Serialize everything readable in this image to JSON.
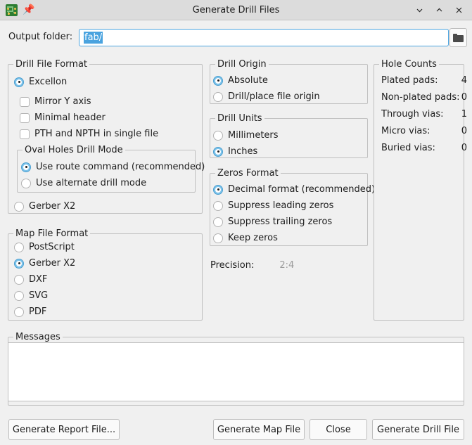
{
  "window": {
    "title": "Generate Drill Files",
    "app_icon": "pcb-board-icon",
    "pin_icon": "pin-icon",
    "controls": [
      {
        "name": "minimize-button",
        "icon": "chevron-down-icon"
      },
      {
        "name": "maximize-button",
        "icon": "chevron-up-icon"
      },
      {
        "name": "close-button",
        "icon": "close-icon"
      }
    ]
  },
  "output": {
    "label": "Output folder:",
    "value": "fab/",
    "browse_icon": "folder-icon"
  },
  "drill_file_format": {
    "title": "Drill File Format",
    "options": [
      {
        "label": "Excellon",
        "selected": true
      },
      {
        "label": "Gerber X2",
        "selected": false
      }
    ],
    "excellon_checks": [
      {
        "label": "Mirror Y axis",
        "checked": false
      },
      {
        "label": "Minimal header",
        "checked": false
      },
      {
        "label": "PTH and NPTH in single file",
        "checked": false
      }
    ],
    "oval_holes": {
      "title": "Oval Holes Drill Mode",
      "options": [
        {
          "label": "Use route command (recommended)",
          "selected": true
        },
        {
          "label": "Use alternate drill mode",
          "selected": false
        }
      ]
    }
  },
  "map_file_format": {
    "title": "Map File Format",
    "options": [
      {
        "label": "PostScript",
        "selected": false
      },
      {
        "label": "Gerber X2",
        "selected": true
      },
      {
        "label": "DXF",
        "selected": false
      },
      {
        "label": "SVG",
        "selected": false
      },
      {
        "label": "PDF",
        "selected": false
      }
    ]
  },
  "drill_origin": {
    "title": "Drill Origin",
    "options": [
      {
        "label": "Absolute",
        "selected": true
      },
      {
        "label": "Drill/place file origin",
        "selected": false
      }
    ]
  },
  "drill_units": {
    "title": "Drill Units",
    "options": [
      {
        "label": "Millimeters",
        "selected": false
      },
      {
        "label": "Inches",
        "selected": true
      }
    ]
  },
  "zeros_format": {
    "title": "Zeros Format",
    "options": [
      {
        "label": "Decimal format (recommended)",
        "selected": true
      },
      {
        "label": "Suppress leading zeros",
        "selected": false
      },
      {
        "label": "Suppress trailing zeros",
        "selected": false
      },
      {
        "label": "Keep zeros",
        "selected": false
      }
    ]
  },
  "precision": {
    "label": "Precision:",
    "value": "2:4",
    "disabled": true
  },
  "hole_counts": {
    "title": "Hole Counts",
    "rows": [
      {
        "label": "Plated pads:",
        "value": "4"
      },
      {
        "label": "Non-plated pads:",
        "value": "0"
      },
      {
        "label": "Through vias:",
        "value": "1"
      },
      {
        "label": "Micro vias:",
        "value": "0"
      },
      {
        "label": "Buried vias:",
        "value": "0"
      }
    ]
  },
  "messages": {
    "title": "Messages",
    "content": ""
  },
  "buttons": {
    "report": "Generate Report File...",
    "map": "Generate Map File",
    "close": "Close",
    "drill": "Generate Drill File"
  },
  "colors": {
    "accent": "#4aa3df",
    "dialog_bg": "#f0f0f0",
    "titlebar_bg": "#dcdcdc",
    "radio_on": "#7ec3ea",
    "disabled_text": "#9a9a9a"
  }
}
